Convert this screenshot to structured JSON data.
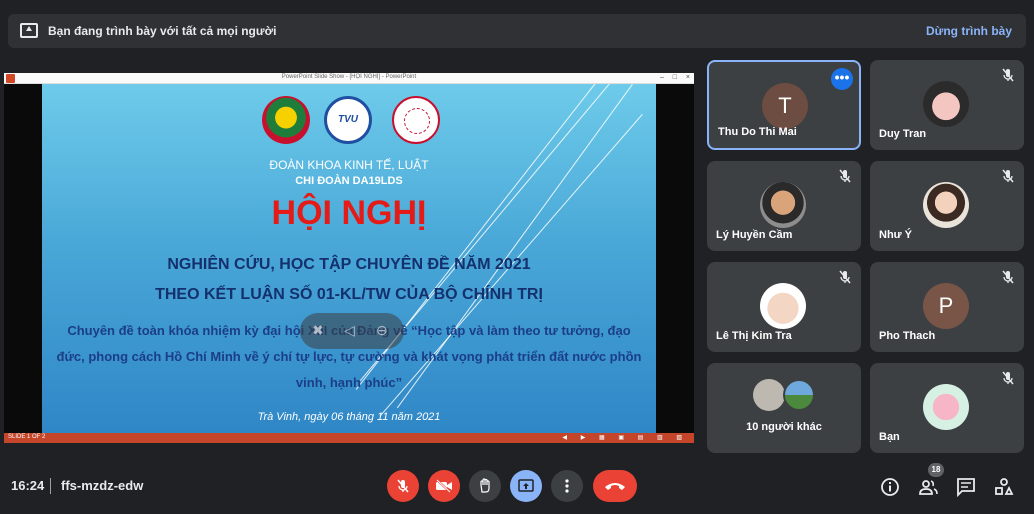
{
  "banner": {
    "text": "Bạn đang trình bày với tất cả mọi người",
    "stop_label": "Dừng trình bày"
  },
  "ppt": {
    "window_title": "PowerPoint Slide Show - [HỘI NGHỊ] - PowerPoint",
    "slide_indicator": "SLIDE 1 OF 2",
    "org": "ĐOÀN KHOA KINH TẾ, LUẬT",
    "chi_doan": "CHI ĐOÀN DA19LDS",
    "headline": "HỘI NGHỊ",
    "line1": "NGHIÊN CỨU, HỌC TẬP CHUYÊN ĐỀ NĂM 2021",
    "line2": "THEO KẾT LUẬN SỐ 01-KL/TW CỦA BỘ CHÍNH TRỊ",
    "line3": "Chuyên đề toàn khóa nhiệm kỳ đại hội XIII của Đảng về “Học tập và làm theo tư tưởng, đạo đức, phong cách Hồ Chí Minh về ý chí tự lực, tự cường và khát vọng phát triển đất nước phồn vinh, hạnh phúc”",
    "date": "Trà Vinh, ngày 06 tháng 11 năm 2021"
  },
  "participants": {
    "tiles": [
      {
        "name": "Thu Do Thi Mai",
        "initial": "T",
        "avatar_color": "#6d4c41"
      },
      {
        "name": "Duy Tran"
      },
      {
        "name": "Lý Huyền Cầm"
      },
      {
        "name": "Như Ý"
      },
      {
        "name": "Lê Thị Kim Tra"
      },
      {
        "name": "Pho Thach",
        "initial": "P",
        "avatar_color": "#795548"
      },
      {
        "others": "10 người khác"
      },
      {
        "name": "Bạn"
      }
    ]
  },
  "bottom": {
    "time": "16:24",
    "meeting_code": "ffs-mzdz-edw",
    "people_count": "18"
  },
  "colors": {
    "accent": "#8ab4f8",
    "danger": "#ea4335",
    "background": "#202124"
  }
}
